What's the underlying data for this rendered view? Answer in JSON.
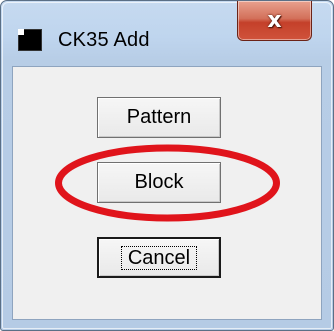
{
  "window": {
    "title": "CK35 Add",
    "close_label": "x"
  },
  "buttons": {
    "pattern_label": "Pattern",
    "block_label": "Block",
    "cancel_label": "Cancel"
  },
  "colors": {
    "frame": "#bfd5ee",
    "client_background": "#f0f0f0",
    "close_button": "#c4402a",
    "highlight_ring": "#e0141b"
  },
  "icons": {
    "app_icon": "black-square-app-icon",
    "close_icon": "x-close-icon"
  },
  "annotations": {
    "highlight": "red ellipse around Block button"
  }
}
